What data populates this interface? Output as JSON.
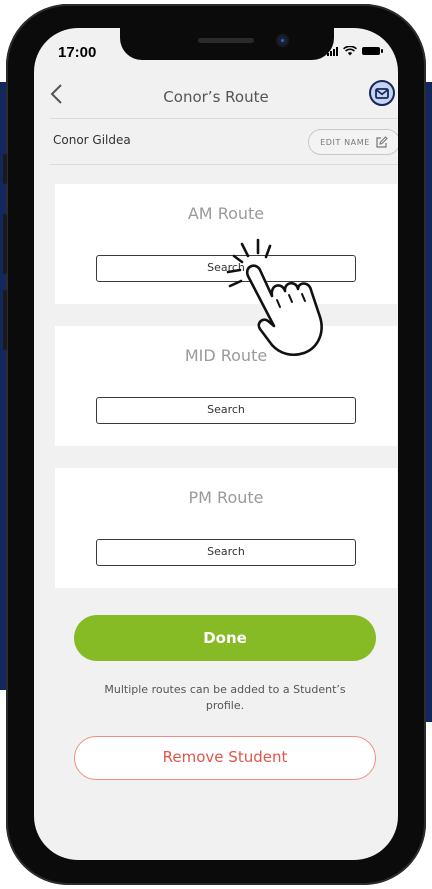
{
  "status_bar": {
    "time": "17:00"
  },
  "header": {
    "title": "Conor’s Route"
  },
  "student": {
    "name": "Conor Gildea",
    "edit_label": "EDIT NAME"
  },
  "routes": [
    {
      "title": "AM Route",
      "button": "Search"
    },
    {
      "title": "MID Route",
      "button": "Search"
    },
    {
      "title": "PM Route",
      "button": "Search"
    }
  ],
  "actions": {
    "done": "Done",
    "info": "Multiple routes can be added to a Student’s profile.",
    "remove": "Remove Student"
  },
  "colors": {
    "brand_navy": "#13275e",
    "done_green": "#86bb25",
    "remove_red": "#e2554a"
  },
  "icons": [
    "back-chevron-icon",
    "mail-icon",
    "edit-icon",
    "tap-hand-icon",
    "signal-icon",
    "wifi-icon",
    "battery-icon"
  ]
}
